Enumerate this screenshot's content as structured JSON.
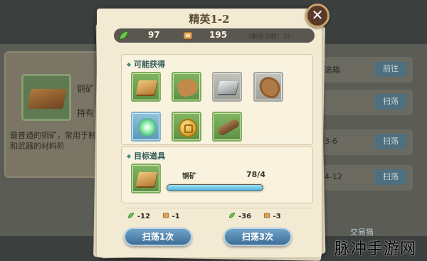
{
  "background": {
    "left_item_name": "铜矿",
    "left_item_tag": "持有",
    "left_item_desc": "最普通的铜矿，常用于制造装备和武器的材料阶",
    "right_rows": [
      {
        "label": "选箱",
        "button": "前往"
      },
      {
        "label": "",
        "button": "扫荡"
      },
      {
        "label": "3-6",
        "button": "扫荡"
      },
      {
        "label": "4-12",
        "button": "扫荡"
      }
    ]
  },
  "dialog": {
    "title": "精英1-2",
    "close_icon": "close-x-icon",
    "resources": {
      "stamina": {
        "icon": "green-leaf-icon",
        "value": "97"
      },
      "tickets": {
        "icon": "scroll-ticket-icon",
        "value": "195"
      },
      "remaining": "（剩余次数：3）"
    },
    "possible_drops": {
      "header": "可能获得",
      "items": [
        {
          "icon": "copper-ingot-icon",
          "rarity": "green"
        },
        {
          "icon": "leather-icon",
          "rarity": "green"
        },
        {
          "icon": "silver-ingot-icon",
          "rarity": "grey"
        },
        {
          "icon": "animal-hide-icon",
          "rarity": "grey"
        },
        {
          "icon": "crystal-flower-icon",
          "rarity": "blue"
        },
        {
          "icon": "gold-coin-icon",
          "rarity": "green"
        },
        {
          "icon": "wood-log-icon",
          "rarity": "green"
        }
      ]
    },
    "target": {
      "header": "目标道具",
      "item_icon": "copper-ingot-icon",
      "name": "铜矿",
      "count": "78/4",
      "progress": 1.0
    },
    "sweep_once": {
      "stamina_cost": "-12",
      "ticket_cost": "-1",
      "label": "扫荡1次"
    },
    "sweep_thrice": {
      "stamina_cost": "-36",
      "ticket_cost": "-3",
      "label": "扫荡3次"
    }
  },
  "watermark": {
    "text": "脉冲手游网",
    "small_text": "交易猫"
  },
  "colors": {
    "panel": "#f3ead4",
    "accent_green": "#3d8f78",
    "button_blue": "#3d6e97",
    "close_bg": "#5a3a2a"
  }
}
